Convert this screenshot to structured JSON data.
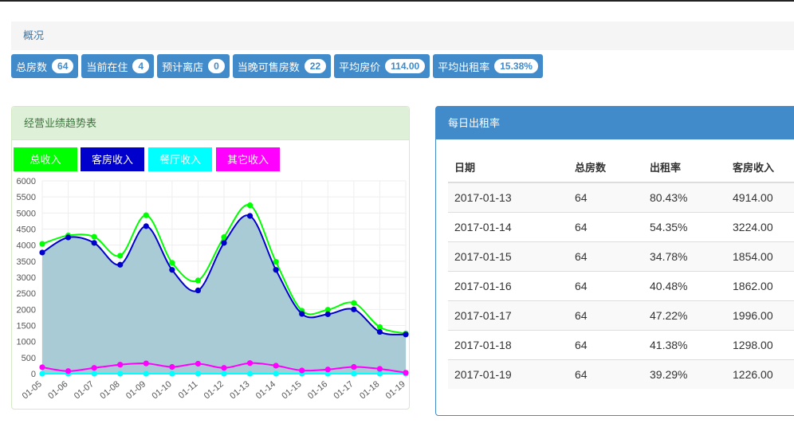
{
  "breadcrumb": {
    "label": "概况"
  },
  "stats": [
    {
      "label": "总房数",
      "value": "64"
    },
    {
      "label": "当前在住",
      "value": "4"
    },
    {
      "label": "预计离店",
      "value": "0"
    },
    {
      "label": "当晚可售房数",
      "value": "22"
    },
    {
      "label": "平均房价",
      "value": "114.00"
    },
    {
      "label": "平均出租率",
      "value": "15.38%"
    }
  ],
  "left_panel": {
    "title": "经营业绩趋势表"
  },
  "right_panel": {
    "title": "每日出租率"
  },
  "colors": {
    "total": "#00ff00",
    "room": "#0000cc",
    "restaurant": "#00ffff",
    "other": "#ff00ff",
    "area_fill": "#a9cbd6"
  },
  "chart_data": {
    "type": "line",
    "categories": [
      "01-05",
      "01-06",
      "01-07",
      "01-08",
      "01-09",
      "01-10",
      "01-11",
      "01-12",
      "01-13",
      "01-14",
      "01-15",
      "01-16",
      "01-17",
      "01-18",
      "01-19"
    ],
    "series": [
      {
        "name": "总收入",
        "values": [
          4040,
          4300,
          4260,
          3670,
          4930,
          3450,
          2900,
          4250,
          5240,
          3480,
          1960,
          1990,
          2200,
          1450,
          1250
        ]
      },
      {
        "name": "客房收入",
        "values": [
          3770,
          4240,
          4070,
          3390,
          4590,
          3230,
          2590,
          4070,
          4910,
          3230,
          1860,
          1850,
          2000,
          1300,
          1220
        ]
      },
      {
        "name": "餐厅收入",
        "values": [
          0,
          0,
          0,
          0,
          0,
          0,
          0,
          0,
          0,
          0,
          0,
          0,
          0,
          0,
          0
        ]
      },
      {
        "name": "其它收入",
        "values": [
          200,
          80,
          180,
          280,
          320,
          210,
          310,
          180,
          330,
          250,
          100,
          130,
          210,
          150,
          30
        ]
      }
    ],
    "ylim": [
      0,
      6000
    ],
    "yticks": [
      "0",
      "500",
      "1000",
      "1500",
      "2000",
      "2500",
      "3000",
      "3500",
      "4000",
      "4500",
      "5000",
      "5500",
      "6000"
    ],
    "grid": true,
    "legend_position": "top-left"
  },
  "table": {
    "headers": [
      "日期",
      "总房数",
      "出租率",
      "客房收入"
    ],
    "rows": [
      [
        "2017-01-13",
        "64",
        "80.43%",
        "4914.00"
      ],
      [
        "2017-01-14",
        "64",
        "54.35%",
        "3224.00"
      ],
      [
        "2017-01-15",
        "64",
        "34.78%",
        "1854.00"
      ],
      [
        "2017-01-16",
        "64",
        "40.48%",
        "1862.00"
      ],
      [
        "2017-01-17",
        "64",
        "47.22%",
        "1996.00"
      ],
      [
        "2017-01-18",
        "64",
        "41.38%",
        "1298.00"
      ],
      [
        "2017-01-19",
        "64",
        "39.29%",
        "1226.00"
      ]
    ]
  }
}
